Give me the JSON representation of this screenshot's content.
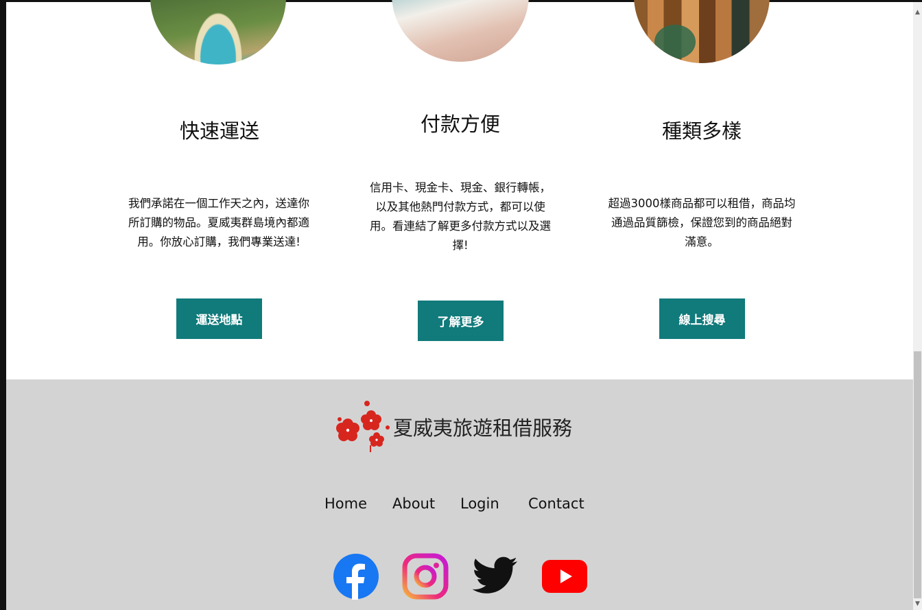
{
  "features": [
    {
      "title": "快速運送",
      "desc_lines": [
        "我們承諾在一個工作天之內，送達你",
        "所訂購的物品。夏威夷群島境內都適",
        "用。你放心訂購，我們專業送達!"
      ],
      "button": "運送地點"
    },
    {
      "title": "付款方便",
      "desc_lines": [
        "信用卡、現金卡、現金、銀行轉帳，",
        "以及其他熱門付款方式，都可以使",
        "用。看連結了解更多付款方式以及選",
        "擇!"
      ],
      "button": "了解更多"
    },
    {
      "title": "種類多樣",
      "desc_lines": [
        "超過3000樣商品都可以租借，商品均",
        "通過品質篩檢，保證您到的商品絕對",
        "滿意。"
      ],
      "button": "線上搜尋"
    }
  ],
  "footer": {
    "brand": "夏威夷旅遊租借服務",
    "nav": [
      "Home",
      "About",
      "Login",
      "Contact"
    ],
    "social": [
      "facebook-icon",
      "instagram-icon",
      "twitter-icon",
      "youtube-icon"
    ]
  },
  "colors": {
    "accent": "#117a7b",
    "footer_bg": "#d3d3d3",
    "hibiscus": "#d7261e"
  }
}
